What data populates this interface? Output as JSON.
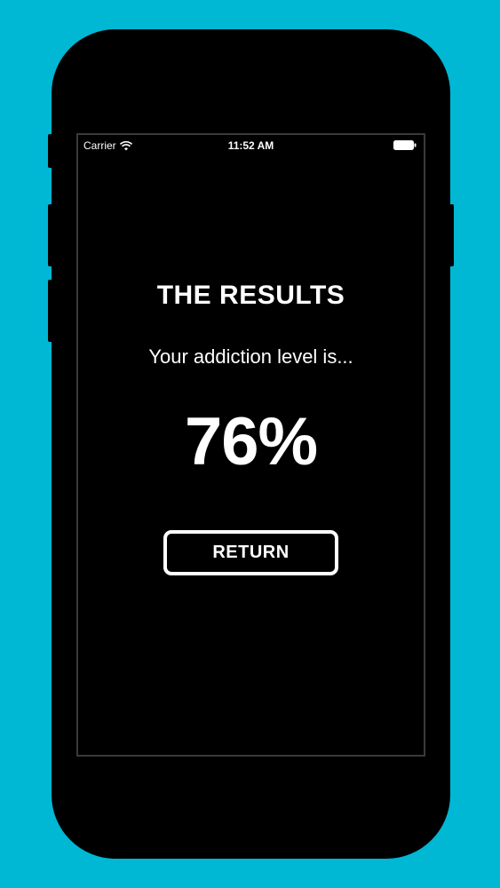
{
  "status_bar": {
    "carrier": "Carrier",
    "time": "11:52 AM",
    "wifi_icon": "wifi-icon",
    "battery_icon": "battery-icon"
  },
  "results": {
    "title": "THE RESULTS",
    "subtitle": "Your addiction level is...",
    "percentage": "76%",
    "return_label": "RETURN"
  },
  "colors": {
    "background": "#00b7d4",
    "phone": "#000000",
    "text": "#ffffff"
  }
}
